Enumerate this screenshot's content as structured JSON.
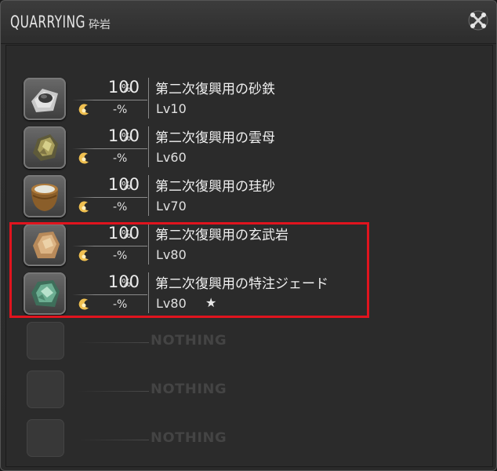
{
  "window": {
    "title": "QUARRYING",
    "subtitle": "砕岩",
    "close_icon": "close-crossed-tools-icon"
  },
  "items": [
    {
      "icon": "iron-sand-icon",
      "rate": "100",
      "rate_unit": "%",
      "bonus": "-%",
      "name": "第二次復興用の砂鉄",
      "level": "Lv10",
      "star": ""
    },
    {
      "icon": "mica-icon",
      "rate": "100",
      "rate_unit": "%",
      "bonus": "-%",
      "name": "第二次復興用の雲母",
      "level": "Lv60",
      "star": ""
    },
    {
      "icon": "silica-sand-icon",
      "rate": "100",
      "rate_unit": "%",
      "bonus": "-%",
      "name": "第二次復興用の珪砂",
      "level": "Lv70",
      "star": ""
    },
    {
      "icon": "basalt-icon",
      "rate": "100",
      "rate_unit": "%",
      "bonus": "-%",
      "name": "第二次復興用の玄武岩",
      "level": "Lv80",
      "star": ""
    },
    {
      "icon": "jade-icon",
      "rate": "100",
      "rate_unit": "%",
      "bonus": "-%",
      "name": "第二次復興用の特注ジェード",
      "level": "Lv80",
      "star": "★"
    }
  ],
  "empty_slots": [
    {
      "label": "NOTHING"
    },
    {
      "label": "NOTHING"
    },
    {
      "label": "NOTHING"
    }
  ],
  "colors": {
    "highlight": "#e0141e",
    "background": "#2b2b2b",
    "text": "#f0f0f0"
  }
}
